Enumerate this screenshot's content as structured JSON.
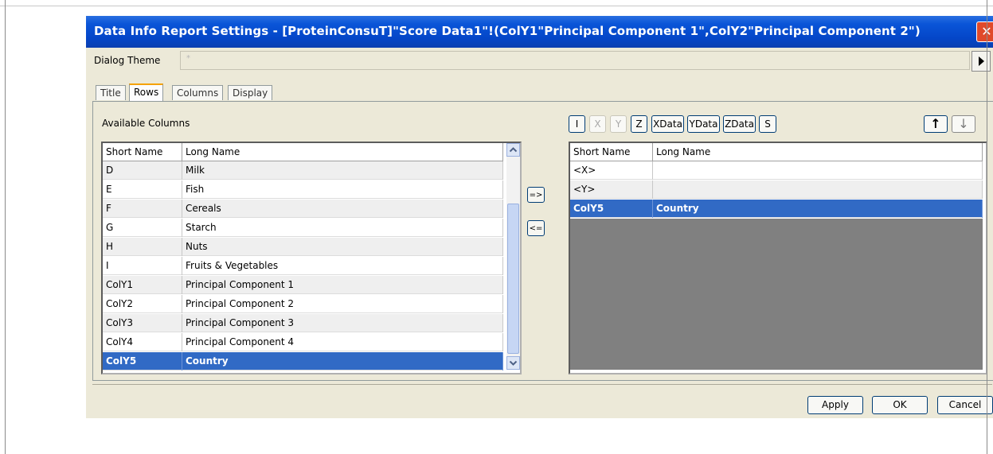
{
  "window": {
    "title": "Data Info Report Settings - [ProteinConsuT]\"Score Data1\"!(ColY1\"Principal Component 1\",ColY2\"Principal Component 2\")"
  },
  "theme": {
    "label": "Dialog Theme",
    "value": "*"
  },
  "tabs": [
    "Title",
    "Rows",
    "Columns",
    "Display"
  ],
  "active_tab": "Rows",
  "available": {
    "label": "Available Columns",
    "headers": [
      "Short Name",
      "Long Name"
    ],
    "rows": [
      [
        "D",
        "Milk"
      ],
      [
        "E",
        "Fish"
      ],
      [
        "F",
        "Cereals"
      ],
      [
        "G",
        "Starch"
      ],
      [
        "H",
        "Nuts"
      ],
      [
        "I",
        "Fruits & Vegetables"
      ],
      [
        "ColY1",
        "Principal Component 1"
      ],
      [
        "ColY2",
        "Principal Component 2"
      ],
      [
        "ColY3",
        "Principal Component 3"
      ],
      [
        "ColY4",
        "Principal Component 4"
      ],
      [
        "ColY5",
        "Country"
      ]
    ],
    "selected_index": 10
  },
  "move": {
    "add": "=>",
    "remove": "<="
  },
  "designation_buttons": [
    "I",
    "X",
    "Y",
    "Z",
    "XData",
    "YData",
    "ZData",
    "S"
  ],
  "designation_disabled": [
    "X",
    "Y"
  ],
  "order_buttons": {
    "up": "↑",
    "down": "↓"
  },
  "selected": {
    "headers": [
      "Short Name",
      "Long Name"
    ],
    "rows": [
      [
        "<X>",
        ""
      ],
      [
        "<Y>",
        ""
      ],
      [
        "ColY5",
        "Country"
      ]
    ],
    "selected_index": 2
  },
  "footer": {
    "apply": "Apply",
    "ok": "OK",
    "cancel": "Cancel"
  },
  "colors": {
    "titlebar": "#0a55d8",
    "selection": "#316ac5",
    "dialog_bg": "#ece9d8"
  }
}
